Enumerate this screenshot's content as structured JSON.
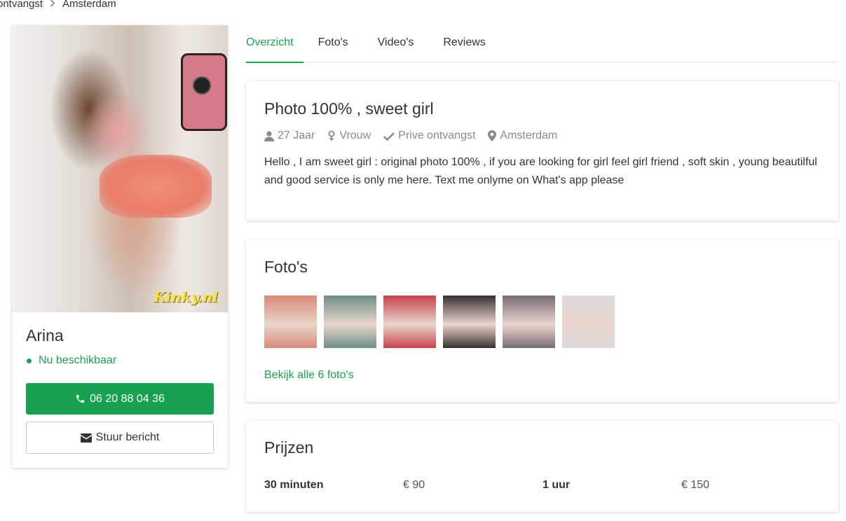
{
  "breadcrumb": {
    "items": [
      "ontvangst",
      "Amsterdam"
    ]
  },
  "profile": {
    "name": "Arina",
    "status": "Nu beschikbaar",
    "phone": "06 20 88 04 36",
    "message_label": "Stuur bericht",
    "watermark": "Kinky.nl"
  },
  "tabs": [
    "Overzicht",
    "Foto's",
    "Video's",
    "Reviews"
  ],
  "overview": {
    "title": "Photo 100% , sweet girl",
    "age": "27 Jaar",
    "gender": "Vrouw",
    "reception": "Prive ontvangst",
    "city": "Amsterdam",
    "description": "Hello , I am sweet girl : original photo 100% , if you are looking for girl feel girl friend , soft skin , young beautilful and good service is only me here. Text me onlyme on What's app please"
  },
  "photos": {
    "title": "Foto's",
    "see_all": "Bekijk alle 6 foto's",
    "thumbnails": [
      {
        "name": "photo-1",
        "bg": "#d88a78"
      },
      {
        "name": "photo-2",
        "bg": "#6d8f86"
      },
      {
        "name": "photo-3",
        "bg": "#c8434a"
      },
      {
        "name": "photo-4",
        "bg": "#3a3030"
      },
      {
        "name": "photo-5",
        "bg": "#7a6c78"
      },
      {
        "name": "photo-6",
        "bg": "#ded8da"
      }
    ]
  },
  "prices": {
    "title": "Prijzen",
    "items": [
      {
        "label": "30 minuten",
        "value": "€ 90"
      },
      {
        "label": "1 uur",
        "value": "€ 150"
      }
    ]
  },
  "colors": {
    "accent": "#18a24f",
    "text": "#333333",
    "muted": "#8a8a8a"
  }
}
